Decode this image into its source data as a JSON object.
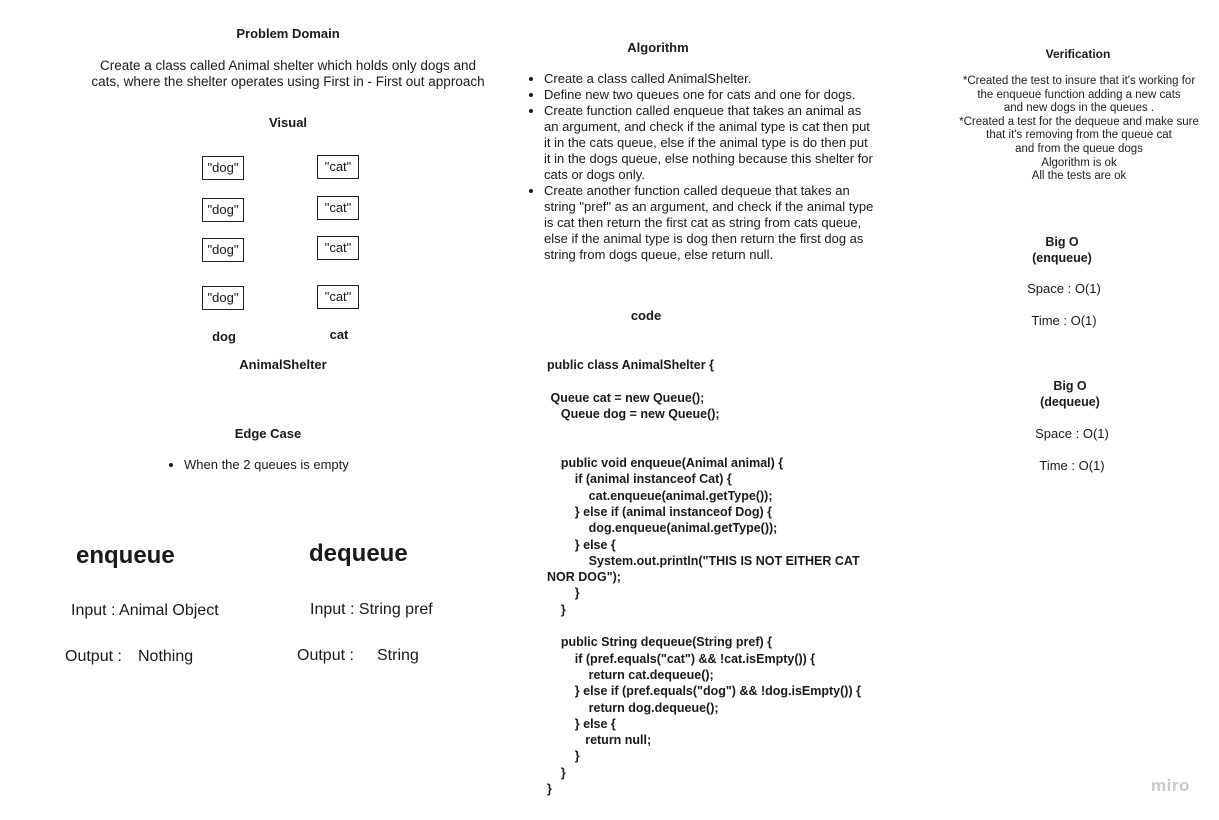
{
  "problem_domain": {
    "title": "Problem Domain",
    "description_line1": "Create a class called Animal shelter which holds only dogs and",
    "description_line2": "cats, where the shelter operates using First in - First out approach"
  },
  "visual": {
    "title": "Visual",
    "dogs": [
      "\"dog\"",
      "\"dog\"",
      "\"dog\"",
      "\"dog\""
    ],
    "cats": [
      "\"cat\"",
      "\"cat\"",
      "\"cat\"",
      "\"cat\""
    ],
    "dog_label": "dog",
    "cat_label": "cat",
    "shelter_label": "AnimalShelter"
  },
  "edge_case": {
    "title": "Edge Case",
    "items": [
      "When the 2 queues is empty"
    ]
  },
  "enqueue_summary": {
    "title": "enqueue",
    "input": "Input : Animal Object",
    "output_label": "Output :",
    "output_value": "Nothing"
  },
  "dequeue_summary": {
    "title": "dequeue",
    "input": "Input : String pref",
    "output_label": "Output :",
    "output_value": "String"
  },
  "algorithm": {
    "title": "Algorithm",
    "items": [
      [
        "Create a class called AnimalShelter."
      ],
      [
        "Define new two queues one for cats and one for dogs."
      ],
      [
        "Create function called enqueue that takes an animal as",
        "an argument, and check if the animal type is cat then put",
        "it in the cats queue, else if the animal type is do then put",
        "it in the dogs queue, else nothing because this shelter for",
        "cats or dogs only."
      ],
      [
        "Create another function called dequeue that takes an",
        "string \"pref\" as an argument, and check if the animal type",
        "is cat then return the first cat as string from cats queue,",
        "else if the animal type is dog then return the first dog as",
        "string from dogs queue, else return null."
      ]
    ]
  },
  "code": {
    "title": "code",
    "lines": [
      "public class AnimalShelter {",
      "",
      " Queue cat = new Queue();",
      "    Queue dog = new Queue();",
      "",
      "",
      "    public void enqueue(Animal animal) {",
      "        if (animal instanceof Cat) {",
      "            cat.enqueue(animal.getType());",
      "        } else if (animal instanceof Dog) {",
      "            dog.enqueue(animal.getType());",
      "        } else {",
      "            System.out.println(\"THIS IS NOT EITHER CAT",
      "NOR DOG\");",
      "        }",
      "    }",
      "",
      "    public String dequeue(String pref) {",
      "        if (pref.equals(\"cat\") && !cat.isEmpty()) {",
      "            return cat.dequeue();",
      "        } else if (pref.equals(\"dog\") && !dog.isEmpty()) {",
      "            return dog.dequeue();",
      "        } else {",
      "           return null;",
      "        }",
      "    }",
      "}"
    ]
  },
  "verification": {
    "title": "Verification",
    "lines": [
      "*Created the test to insure that it's working for",
      "the enqueue function adding a new cats",
      "and new dogs in the queues .",
      "*Created a test for the dequeue and make sure",
      "that it's removing from the queue cat",
      "and from the queue dogs",
      "Algorithm is ok",
      "All the tests are ok"
    ]
  },
  "big_o_enqueue": {
    "title_line1": "Big O",
    "title_line2": "(enqueue)",
    "space": "Space : O(1)",
    "time": "Time : O(1)"
  },
  "big_o_dequeue": {
    "title_line1": "Big O",
    "title_line2": "(dequeue)",
    "space": "Space : O(1)",
    "time": "Time : O(1)"
  },
  "watermark": "miro"
}
